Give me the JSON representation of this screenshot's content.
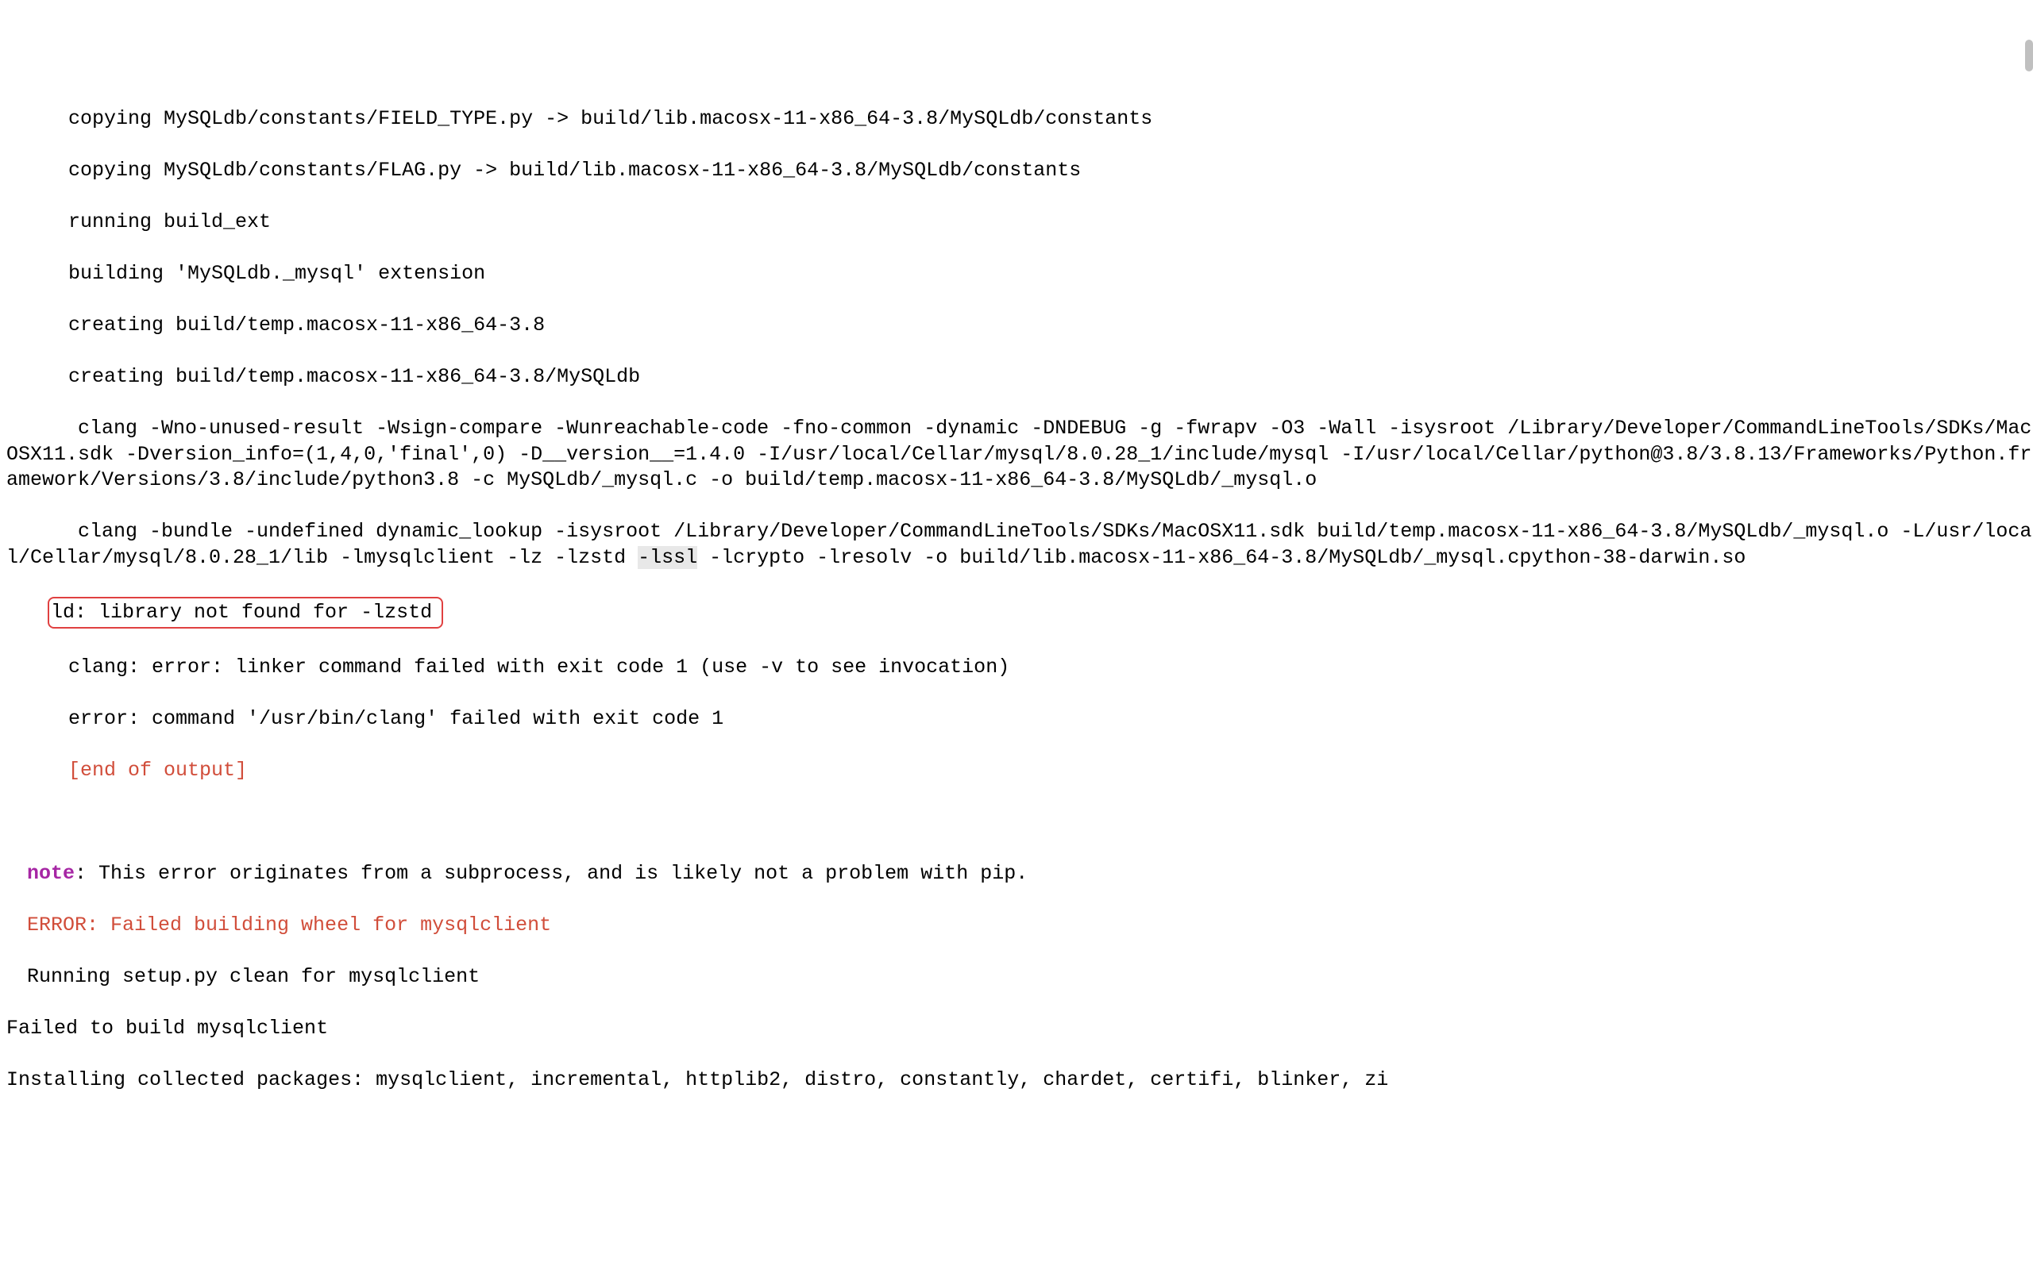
{
  "lines": {
    "l1": "copying MySQLdb/constants/FIELD_TYPE.py -> build/lib.macosx-11-x86_64-3.8/MySQLdb/constants",
    "l2": "copying MySQLdb/constants/FLAG.py -> build/lib.macosx-11-x86_64-3.8/MySQLdb/constants",
    "l3": "running build_ext",
    "l4": "building 'MySQLdb._mysql' extension",
    "l5": "creating build/temp.macosx-11-x86_64-3.8",
    "l6": "creating build/temp.macosx-11-x86_64-3.8/MySQLdb",
    "l7a": "      clang -Wno-unused-result -Wsign-compare -Wunreachable-code -fno-common -dynamic -DNDEBUG -g -fwrapv -O3 -Wall -isysroot /Library/Developer/CommandLineTools/SDKs/MacOSX11.sdk -Dversion_info=(1,4,0,'final',0) -D__version__=1.4.0 -I/usr/local/Cellar/mysql/8.0.28_1/include/mysql -I/usr/local/Cellar/python@3.8/3.8.13/Frameworks/Python.framework/Versions/3.8/include/python3.8 -c MySQLdb/_mysql.c -o build/temp.macosx-11-x86_64-3.8/MySQLdb/_mysql.o",
    "l8a": "      clang -bundle -undefined dynamic_lookup -isysroot /Library/Developer/CommandLineTools/SDKs/MacOSX11.sdk build/temp.macosx-11-x86_64-3.8/MySQLdb/_mysql.o -L/usr/local/Cellar/mysql/8.0.28_1/lib -lmysqlclient -lz -lzstd ",
    "l8b": "-lssl",
    "l8c": " -lcrypto -lresolv -o build/lib.macosx-11-x86_64-3.8/MySQLdb/_mysql.cpython-38-darwin.so",
    "l9": "ld: library not found for -lzstd",
    "l10": "clang: error: linker command failed with exit code 1 (use -v to see invocation)",
    "l11": "error: command '/usr/bin/clang' failed with exit code 1",
    "l12": "[end of output]",
    "l13a": "note",
    "l13b": ": This error originates from a subprocess, and is likely not a problem with pip.",
    "l14": "ERROR: Failed building wheel for mysqlclient",
    "l15": "Running setup.py clean for mysqlclient",
    "l16": "Failed to build mysqlclient",
    "l17": "Installing collected packages: mysqlclient, incremental, httplib2, distro, constantly, chardet, certifi, blinker, zi"
  }
}
